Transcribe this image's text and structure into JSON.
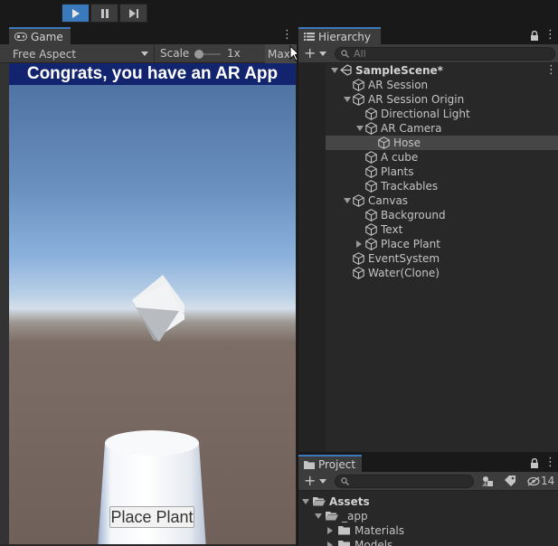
{
  "toolbar": {
    "play_icon": "play-icon",
    "pause_icon": "pause-icon",
    "step_icon": "step-icon",
    "accent": "#3a79bb"
  },
  "game": {
    "tab_label": "Game",
    "aspect_label": "Free Aspect",
    "scale_label": "Scale",
    "scale_value": "1x",
    "maximize_label": "Maxi",
    "banner_text": "Congrats, you have an AR App",
    "button_label": "Place Plant"
  },
  "hierarchy": {
    "tab_label": "Hierarchy",
    "search_placeholder": "All",
    "items": [
      {
        "label": "SampleScene*",
        "depth": 0,
        "fold": "down",
        "type": "scene",
        "bold": true
      },
      {
        "label": "AR Session",
        "depth": 1,
        "fold": "none",
        "type": "gameobject"
      },
      {
        "label": "AR Session Origin",
        "depth": 1,
        "fold": "down",
        "type": "gameobject"
      },
      {
        "label": "Directional Light",
        "depth": 2,
        "fold": "none",
        "type": "gameobject"
      },
      {
        "label": "AR Camera",
        "depth": 2,
        "fold": "down",
        "type": "gameobject"
      },
      {
        "label": "Hose",
        "depth": 3,
        "fold": "none",
        "type": "gameobject",
        "selected": true
      },
      {
        "label": "A cube",
        "depth": 2,
        "fold": "none",
        "type": "gameobject"
      },
      {
        "label": "Plants",
        "depth": 2,
        "fold": "none",
        "type": "gameobject"
      },
      {
        "label": "Trackables",
        "depth": 2,
        "fold": "none",
        "type": "gameobject"
      },
      {
        "label": "Canvas",
        "depth": 1,
        "fold": "down",
        "type": "gameobject"
      },
      {
        "label": "Background",
        "depth": 2,
        "fold": "none",
        "type": "gameobject"
      },
      {
        "label": "Text",
        "depth": 2,
        "fold": "none",
        "type": "gameobject"
      },
      {
        "label": "Place Plant",
        "depth": 2,
        "fold": "right",
        "type": "gameobject"
      },
      {
        "label": "EventSystem",
        "depth": 1,
        "fold": "none",
        "type": "gameobject"
      },
      {
        "label": "Water(Clone)",
        "depth": 1,
        "fold": "none",
        "type": "gameobject"
      }
    ]
  },
  "project": {
    "tab_label": "Project",
    "search_placeholder": "",
    "hidden_count": "14",
    "tree": [
      {
        "label": "Assets",
        "depth": 0,
        "fold": "down",
        "bold": true
      },
      {
        "label": "_app",
        "depth": 1,
        "fold": "down"
      },
      {
        "label": "Materials",
        "depth": 2,
        "fold": "right"
      },
      {
        "label": "Models",
        "depth": 2,
        "fold": "right"
      }
    ]
  }
}
